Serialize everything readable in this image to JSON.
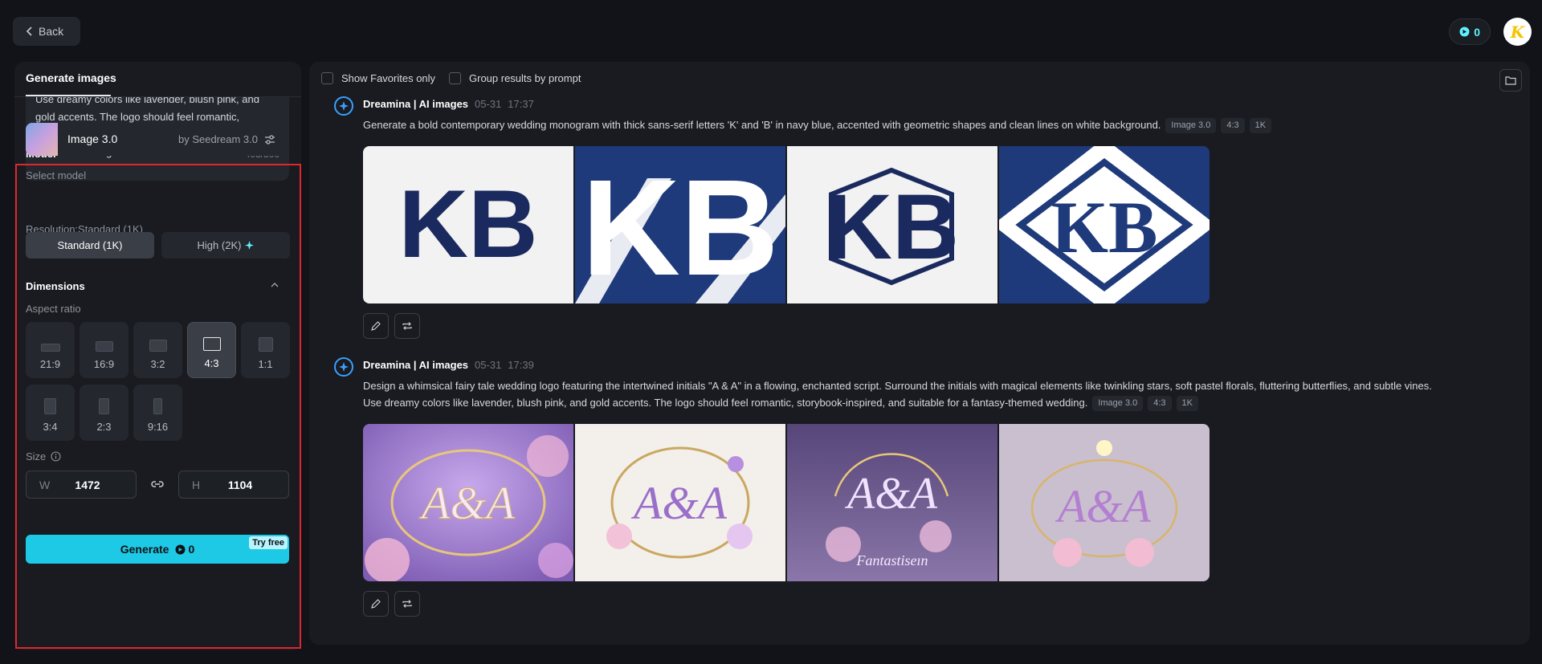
{
  "topbar": {
    "back_label": "Back",
    "credits": "0",
    "avatar_letter": "K"
  },
  "left_panel": {
    "tab_label": "Generate images",
    "prompt_text": "Use dreamy colors like lavender, blush pink, and gold accents. The logo should feel romantic, storybook-inspired, and suitable for a fantasy-themed wedding.",
    "char_count": "403/800",
    "model": {
      "section_title": "Model",
      "select_label": "Select model",
      "name": "Image 3.0",
      "provider": "by Seedream 3.0",
      "resolution_label": "Resolution:Standard (1K)",
      "res_standard": "Standard (1K)",
      "res_high": "High (2K)"
    },
    "dimensions": {
      "section_title": "Dimensions",
      "aspect_label": "Aspect ratio",
      "ratios": [
        "21:9",
        "16:9",
        "3:2",
        "4:3",
        "1:1",
        "3:4",
        "2:3",
        "9:16"
      ],
      "selected": "4:3",
      "size_label": "Size",
      "w_label": "W",
      "w_value": "1472",
      "h_label": "H",
      "h_value": "1104"
    },
    "generate_label": "Generate",
    "generate_cost": "0",
    "try_free": "Try free"
  },
  "results": {
    "show_favorites": "Show Favorites only",
    "group_by_prompt": "Group results by prompt",
    "groups": [
      {
        "source": "Dreamina | AI images",
        "date": "05-31",
        "time": "17:37",
        "prompt": "Generate a bold contemporary wedding monogram with thick sans-serif letters 'K' and 'B' in navy blue, accented with geometric shapes and clean lines on white background.",
        "tags": [
          "Image 3.0",
          "4:3",
          "1K"
        ],
        "images": [
          {
            "letters": "KB",
            "bg": "#f2f2f2",
            "fg": "#1b2a5e"
          },
          {
            "letters": "KB",
            "bg": "#1e3a7a",
            "fg": "#ffffff"
          },
          {
            "letters": "KB",
            "bg": "#f2f2f2",
            "fg": "#1b2a5e"
          },
          {
            "letters": "KB",
            "bg": "#1e3a7a",
            "fg": "#ffffff"
          }
        ]
      },
      {
        "source": "Dreamina | AI images",
        "date": "05-31",
        "time": "17:39",
        "prompt_line1": "Design a whimsical fairy tale wedding logo featuring the intertwined initials \"A & A\" in a flowing, enchanted script. Surround the initials with magical elements like twinkling stars, soft pastel florals, fluttering butterflies, and subtle vines.",
        "prompt_line2": "Use dreamy colors like lavender, blush pink, and gold accents. The logo should feel romantic, storybook-inspired, and suitable for a fantasy-themed wedding.",
        "tags": [
          "Image 3.0",
          "4:3",
          "1K"
        ],
        "images": [
          {
            "letters": "A&A",
            "bg": "#8a6bc0",
            "fg": "#f4e9ff"
          },
          {
            "letters": "A&A",
            "bg": "#f3efea",
            "fg": "#9a6fc9"
          },
          {
            "letters": "A&A",
            "bg": "#6b5a8e",
            "fg": "#f0e3ff",
            "caption": "Fantastiseın"
          },
          {
            "letters": "A&A",
            "bg": "#c9bfcf",
            "fg": "#b47fd0"
          }
        ]
      }
    ]
  }
}
